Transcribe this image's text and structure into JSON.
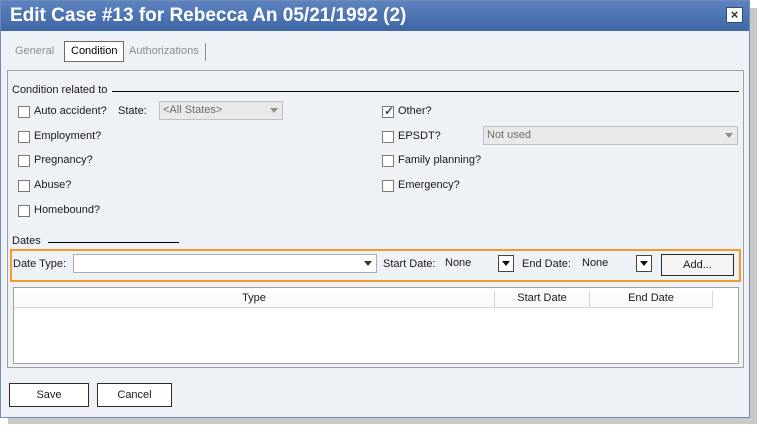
{
  "window": {
    "title": "Edit Case #13 for Rebecca An 05/21/1992 (2)",
    "close_glyph": "×"
  },
  "tabs": [
    {
      "label": "General"
    },
    {
      "label": "Condition"
    },
    {
      "label": "Authorizations"
    }
  ],
  "condition": {
    "section_label": "Condition related to",
    "auto_accident": {
      "label": "Auto accident?",
      "checked": false
    },
    "state_label": "State:",
    "state_value": "<All States>",
    "employment": {
      "label": "Employment?",
      "checked": false
    },
    "pregnancy": {
      "label": "Pregnancy?",
      "checked": false
    },
    "abuse": {
      "label": "Abuse?",
      "checked": false
    },
    "homebound": {
      "label": "Homebound?",
      "checked": false
    },
    "other": {
      "label": "Other?",
      "checked": true
    },
    "epsdt": {
      "label": "EPSDT?",
      "checked": false
    },
    "epsdt_value": "Not used",
    "family_planning": {
      "label": "Family planning?",
      "checked": false
    },
    "emergency": {
      "label": "Emergency?",
      "checked": false
    }
  },
  "dates": {
    "section_label": "Dates",
    "date_type_label": "Date Type:",
    "date_type_value": "",
    "start_date_label": "Start Date:",
    "start_date_value": "None",
    "end_date_label": "End Date:",
    "end_date_value": "None",
    "add_label": "Add...",
    "columns": [
      "Type",
      "Start Date",
      "End Date"
    ],
    "rows": []
  },
  "footer": {
    "save_label": "Save",
    "cancel_label": "Cancel"
  },
  "colors": {
    "titlebar": "#4a72b2",
    "highlight": "#f39a2d",
    "background": "#eef1f6"
  }
}
